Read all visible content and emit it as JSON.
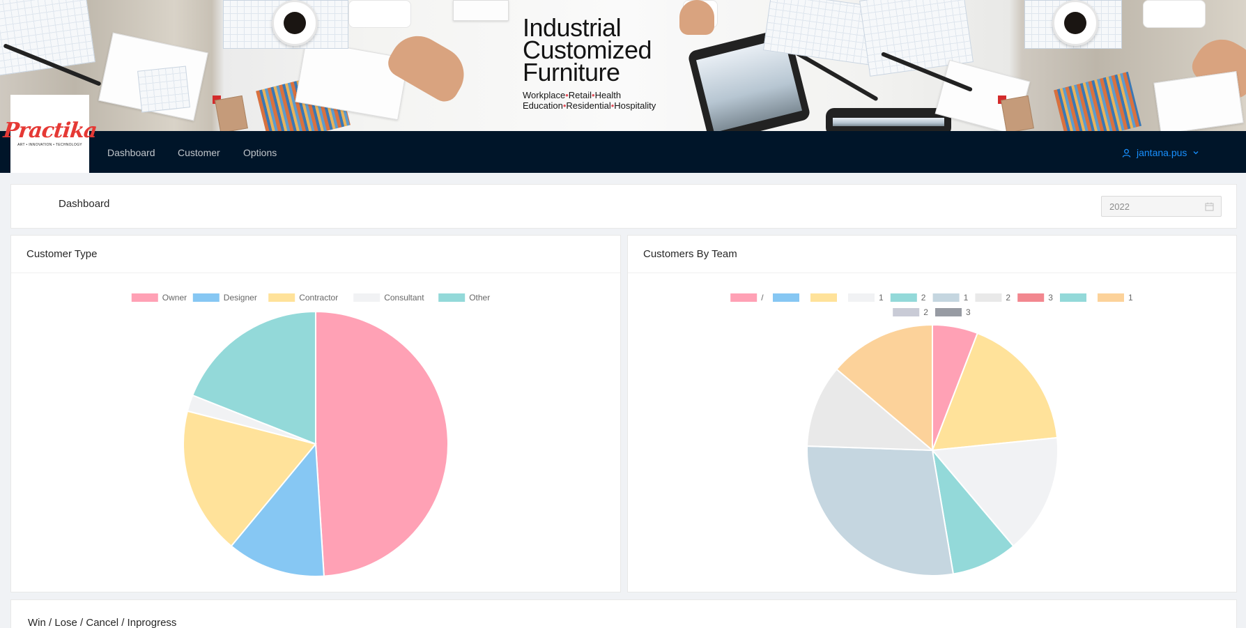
{
  "banner": {
    "title_lines": [
      "Industrial",
      "Customized",
      "Furniture"
    ],
    "tag_line_1": [
      "Workplace",
      "Retail",
      "Health"
    ],
    "tag_line_2": [
      "Education",
      "Residential",
      "Hospitality"
    ]
  },
  "logo": {
    "word": "Practika",
    "tagline": "ART • INNOVATION • TECHNOLOGY"
  },
  "nav": {
    "items": [
      "Dashboard",
      "Customer",
      "Options"
    ],
    "user": "jantana.pus"
  },
  "header": {
    "title": "Dashboard",
    "year": "2022"
  },
  "colors": {
    "navbar": "#001529",
    "accent": "#1890ff",
    "pink": "#ffa1b5",
    "blue": "#86c7f3",
    "yellow": "#ffe29a",
    "light": "#f1f2f4",
    "teal": "#93d9d9",
    "steel": "#c5d6e0",
    "gray": "#e9e9e9",
    "red": "#f2878f",
    "orange": "#fcd29a",
    "lavender": "#c9cbd6",
    "slate": "#979ba3"
  },
  "cards": {
    "customer_type": "Customer Type",
    "customers_by_team": "Customers By Team",
    "win_lose": "Win / Lose / Cancel / Inprogress"
  },
  "chart_data": [
    {
      "type": "pie",
      "title": "Customer Type",
      "legend_position": "top",
      "categories": [
        "Owner",
        "Designer",
        "Contractor",
        "Consultant",
        "Other"
      ],
      "values": [
        49,
        12,
        18,
        2,
        19
      ],
      "colors": [
        "#ffa1b5",
        "#86c7f3",
        "#ffe29a",
        "#f1f2f4",
        "#93d9d9"
      ]
    },
    {
      "type": "pie",
      "title": "Customers By Team",
      "legend_position": "top",
      "categories": [
        "/",
        "",
        "",
        "1",
        "2",
        "1",
        "2",
        "3",
        "",
        "1",
        "2",
        "3"
      ],
      "values": [
        5.5,
        0,
        16.5,
        14.5,
        8,
        26.5,
        10,
        0,
        0,
        13,
        0,
        0
      ],
      "colors": [
        "#ffa1b5",
        "#86c7f3",
        "#ffe29a",
        "#f1f2f4",
        "#93d9d9",
        "#c5d6e0",
        "#e9e9e9",
        "#f2878f",
        "#93d9d9",
        "#fcd29a",
        "#c9cbd6",
        "#979ba3"
      ]
    }
  ]
}
